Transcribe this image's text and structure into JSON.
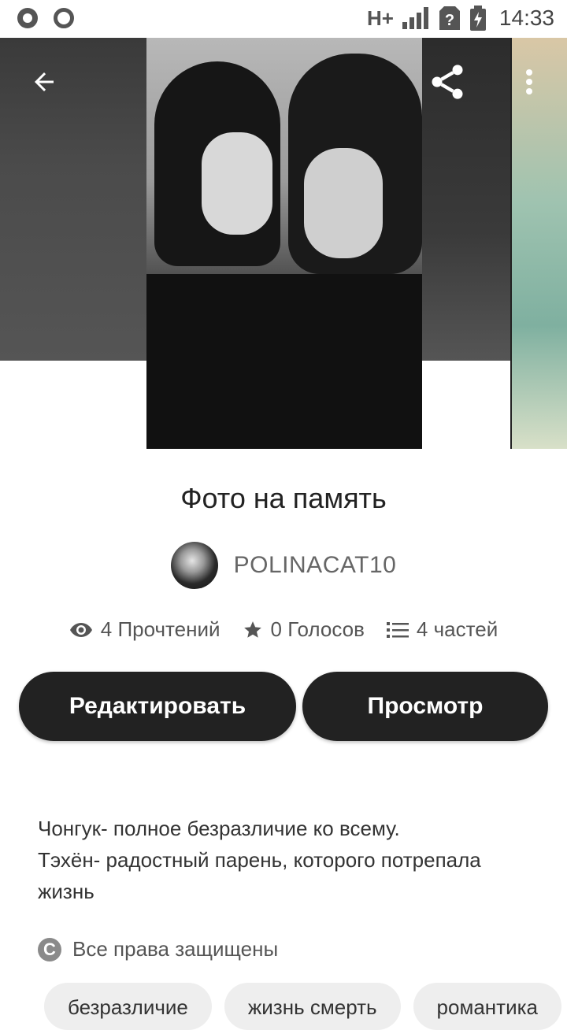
{
  "status_bar": {
    "network": "H+",
    "time": "14:33"
  },
  "story": {
    "title": "Фото на память",
    "author": "POLINACAT10",
    "stats": {
      "reads": "4 Прочтений",
      "votes": "0 Голосов",
      "parts": "4 частей"
    },
    "buttons": {
      "edit": "Редактировать",
      "view": "Просмотр"
    },
    "description_lines": [
      "Чонгук- полное безразличие ко всему.",
      "Тэхён- радостный парень, которого потрепала жизнь"
    ],
    "copyright": "Все права защищены",
    "tags": [
      "безразличие",
      "жизнь смерть",
      "романтика"
    ]
  },
  "icons": {
    "back": "arrow-back-icon",
    "share": "share-icon",
    "more": "more-vert-icon",
    "reads": "eye-icon",
    "votes": "star-icon",
    "parts": "list-icon",
    "copyright": "copyright-icon"
  }
}
